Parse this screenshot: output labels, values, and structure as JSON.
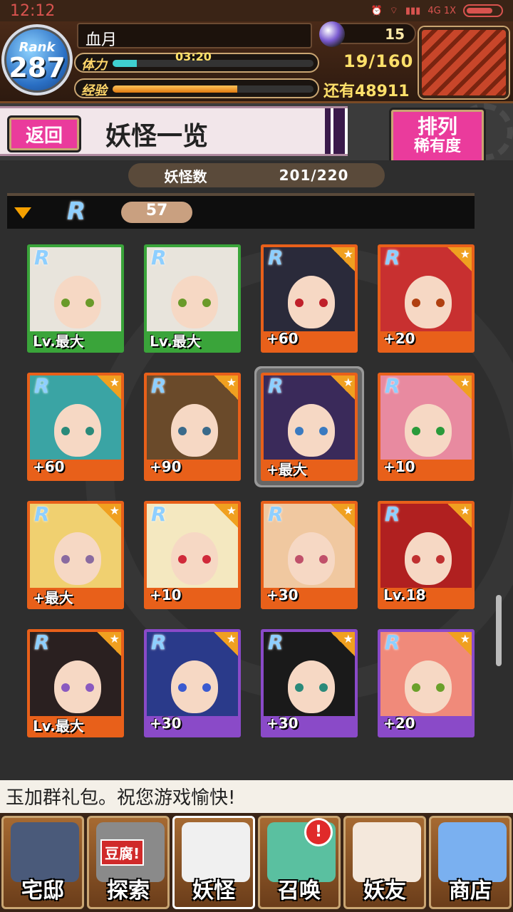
{
  "status_bar": {
    "time": "12:12",
    "network": "4G 1X"
  },
  "header": {
    "rank_label": "Rank",
    "rank_value": "287",
    "player_name": "血月",
    "gem_count": "15",
    "stamina_label": "体力",
    "stamina_timer": "03:20",
    "stamina_count": "19/160",
    "stamina_fraction": 0.12,
    "exp_label": "经验",
    "exp_remaining": "还有48911",
    "exp_fraction": 0.62
  },
  "titlebar": {
    "back_label": "返回",
    "page_title": "妖怪一览",
    "sort_label": "排列",
    "sort_mode": "稀有度"
  },
  "list": {
    "count_label": "妖怪数",
    "count_value": "201/220",
    "group_rarity": "R",
    "group_count": "57",
    "cards": [
      {
        "rarity": "R",
        "level": "Lv.最大",
        "frame": "green",
        "eye": "#6a9a2a",
        "hair": "#e8e4dc"
      },
      {
        "rarity": "R",
        "level": "Lv.最大",
        "frame": "green",
        "eye": "#6a9a2a",
        "hair": "#e8e4dc"
      },
      {
        "rarity": "R",
        "level": "+60",
        "frame": "orange",
        "eye": "#c0202a",
        "hair": "#2a2a3a"
      },
      {
        "rarity": "R",
        "level": "+20",
        "frame": "orange",
        "eye": "#b04010",
        "hair": "#c83030"
      },
      {
        "rarity": "R",
        "level": "+60",
        "frame": "orange",
        "eye": "#2a8a7a",
        "hair": "#3aa4a4"
      },
      {
        "rarity": "R",
        "level": "+90",
        "frame": "orange",
        "eye": "#3a6a8a",
        "hair": "#6a4a2a"
      },
      {
        "rarity": "R",
        "level": "+最大",
        "frame": "orange",
        "eye": "#3a7ac0",
        "hair": "#3a2a5a"
      },
      {
        "rarity": "R",
        "level": "+10",
        "frame": "orange",
        "eye": "#2a9a3a",
        "hair": "#e88aa0"
      },
      {
        "rarity": "R",
        "level": "+最大",
        "frame": "orange",
        "eye": "#8a6aa0",
        "hair": "#f0d070"
      },
      {
        "rarity": "R",
        "level": "+10",
        "frame": "orange",
        "eye": "#d02a3a",
        "hair": "#f4e8c0"
      },
      {
        "rarity": "R",
        "level": "+30",
        "frame": "orange",
        "eye": "#c0506a",
        "hair": "#f0c8a0"
      },
      {
        "rarity": "R",
        "level": "Lv.18",
        "frame": "orange",
        "eye": "#c03030",
        "hair": "#b02020"
      },
      {
        "rarity": "R",
        "level": "Lv.最大",
        "frame": "orange",
        "eye": "#8a5ac0",
        "hair": "#2a2020"
      },
      {
        "rarity": "R",
        "level": "+30",
        "frame": "purple",
        "eye": "#3a5ad0",
        "hair": "#2a3a8a"
      },
      {
        "rarity": "R",
        "level": "+30",
        "frame": "purple",
        "eye": "#2a8a7a",
        "hair": "#1a1a1a"
      },
      {
        "rarity": "R",
        "level": "+20",
        "frame": "purple",
        "eye": "#6aa02a",
        "hair": "#f08a7a"
      }
    ]
  },
  "ticker": {
    "text": "玉加群礼包。祝您游戏愉快!"
  },
  "nav": {
    "items": [
      {
        "label": "宅邸",
        "art": "#4a5a7a"
      },
      {
        "label": "探索",
        "art": "#8a8a8a"
      },
      {
        "label": "妖怪",
        "art": "#f0f0f0"
      },
      {
        "label": "召唤",
        "art": "#5ac0a0"
      },
      {
        "label": "妖友",
        "art": "#f4e8dc"
      },
      {
        "label": "商店",
        "art": "#7ab0f0"
      }
    ],
    "tofu_badge": "豆腐!",
    "alert_badge": "!"
  },
  "colors": {
    "accent_pink": "#ea3b9c",
    "frame_orange": "#e8601a",
    "frame_green": "#3aa43a",
    "frame_purple": "#8a4ac8"
  }
}
